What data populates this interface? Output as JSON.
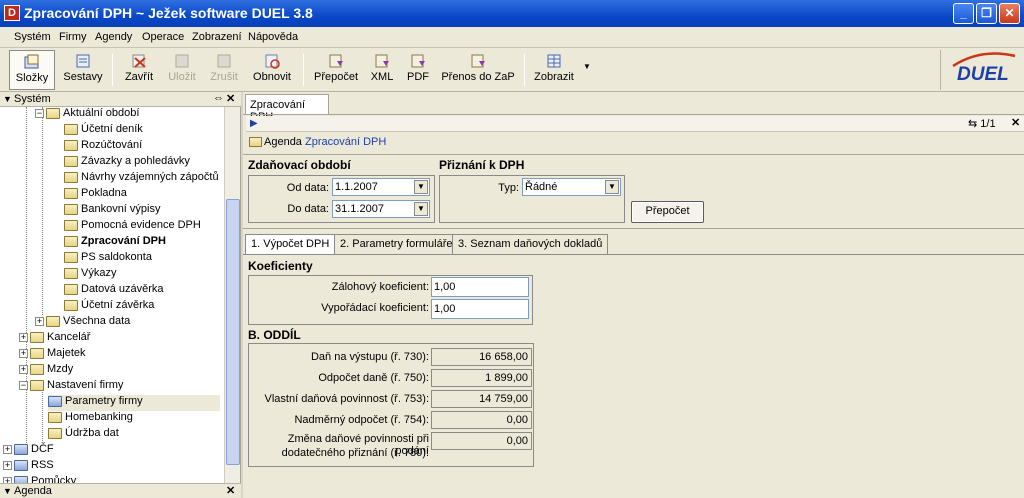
{
  "window": {
    "app_icon": "D",
    "title": "Zpracování DPH ~ Ježek software DUEL 3.8",
    "controls": [
      "minimize-icon",
      "restore-icon",
      "close-icon"
    ]
  },
  "menu": [
    "Systém",
    "Firmy",
    "Agendy",
    "Operace",
    "Zobrazení",
    "Nápověda"
  ],
  "toolbar": {
    "buttons": [
      {
        "label": "Složky",
        "icon": "folders-icon"
      },
      {
        "label": "Sestavy",
        "icon": "reports-icon"
      },
      {
        "label": "Zavřít",
        "icon": "close-doc-icon"
      },
      {
        "label": "Uložit",
        "icon": "save-icon"
      },
      {
        "label": "Zrušit",
        "icon": "cancel-icon"
      },
      {
        "label": "Obnovit",
        "icon": "refresh-icon"
      },
      {
        "label": "Přepočet",
        "icon": "recalc-icon"
      },
      {
        "label": "XML",
        "icon": "xml-icon"
      },
      {
        "label": "PDF",
        "icon": "pdf-icon"
      },
      {
        "label": "Přenos do ZaP",
        "icon": "transfer-icon"
      },
      {
        "label": "Zobrazit",
        "icon": "grid-icon"
      }
    ],
    "logo": "DUEL"
  },
  "left_panel": {
    "header": "Systém",
    "footer": "Agenda",
    "tree": [
      {
        "label": "Aktuální období"
      },
      {
        "label": "Účetní deník"
      },
      {
        "label": "Rozúčtování"
      },
      {
        "label": "Závazky a pohledávky"
      },
      {
        "label": "Návrhy vzájemných zápočtů"
      },
      {
        "label": "Pokladna"
      },
      {
        "label": "Bankovní výpisy"
      },
      {
        "label": "Pomocná evidence DPH"
      },
      {
        "label": "Zpracování DPH"
      },
      {
        "label": "PS saldokonta"
      },
      {
        "label": "Výkazy"
      },
      {
        "label": "Datová uzávěrka"
      },
      {
        "label": "Účetní závěrka"
      },
      {
        "label": "Všechna data"
      },
      {
        "label": "Kancelář"
      },
      {
        "label": "Majetek"
      },
      {
        "label": "Mzdy"
      },
      {
        "label": "Nastavení firmy"
      },
      {
        "label": "Parametry firmy"
      },
      {
        "label": "Homebanking"
      },
      {
        "label": "Údržba dat"
      },
      {
        "label": "DČF"
      },
      {
        "label": "RSS"
      },
      {
        "label": "Pomůcky"
      }
    ]
  },
  "main": {
    "doc_tab": "Zpracování DPH",
    "pager": "1/1",
    "agenda_prefix": "Agenda",
    "agenda_link": "Zpracování DPH",
    "period": {
      "title": "Zdaňovací období",
      "from_label": "Od data:",
      "from_value": "1.1.2007",
      "to_label": "Do data:",
      "to_value": "31.1.2007"
    },
    "declaration": {
      "title": "Přiznání k DPH",
      "type_label": "Typ:",
      "type_value": "Řádné",
      "recalc_button": "Přepočet"
    },
    "tabs": [
      "1. Výpočet DPH",
      "2. Parametry formuláře",
      "3. Seznam daňových dokladů"
    ],
    "coef": {
      "title": "Koeficienty",
      "advance_label": "Zálohový koeficient:",
      "advance_value": "1,00",
      "settle_label": "Vypořádací koeficient:",
      "settle_value": "1,00"
    },
    "section_b": {
      "title": "B. ODDÍL",
      "rows": [
        {
          "label": "Daň na výstupu (ř. 730):",
          "value": "16 658,00"
        },
        {
          "label": "Odpočet daně (ř. 750):",
          "value": "1 899,00"
        },
        {
          "label": "Vlastní daňová povinnost (ř. 753):",
          "value": "14 759,00"
        },
        {
          "label": "Nadměrný odpočet (ř. 754):",
          "value": "0,00"
        }
      ],
      "last_label_1": "Změna daňové povinnosti při podání",
      "last_label_2": "dodatečného přiznání (ř. 780):",
      "last_value": "0,00"
    }
  }
}
